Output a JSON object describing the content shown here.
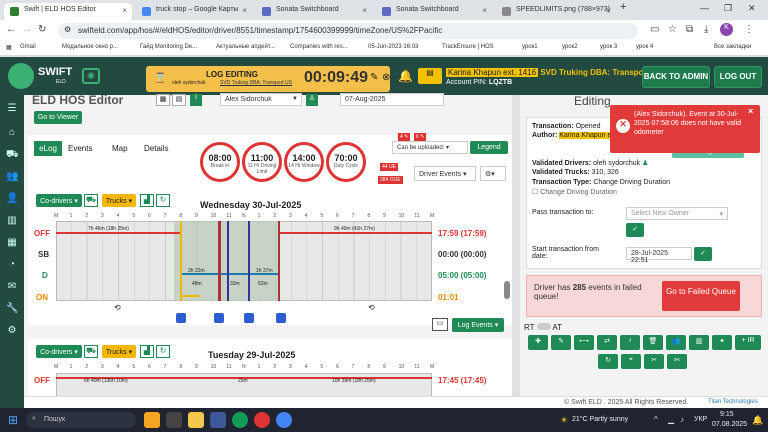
{
  "browser": {
    "tabs": [
      {
        "title": "Swift | ELD HOS Editor",
        "color": "#2e7d32",
        "active": true
      },
      {
        "title": "truck stop – Google Карты",
        "color": "#4285f4"
      },
      {
        "title": "Sonata Switchboard",
        "color": "#555"
      },
      {
        "title": "Sonata Switchboard",
        "color": "#555"
      },
      {
        "title": "SPEEDLIMITS.png (788×973)",
        "color": "#777"
      }
    ],
    "new_tab": "+",
    "url": "swifteld.com/app/hos/#/eldHOS/editor/driver/8551/timestamp/1754600399999/timeZone/US%2FPacific",
    "profile": "K",
    "bookmarks": [
      "Gmail",
      "Модальное окно р...",
      "Гайд Monitoring De...",
      "Актуальные апдейт...",
      "Companies with res...",
      "05-Jun-2023 16:03",
      "TrackEnsure | HOS",
      "урок1",
      "урок2",
      "урок 3",
      "урок 4",
      "Все закладки"
    ]
  },
  "header": {
    "logo": "SWIFT",
    "logo_sub": "ELD",
    "log_editing_label": "LOG EDITING",
    "log_editing_user": "oleh sydorchuk",
    "log_editing_company": "SVD Truking DBA: Transport US",
    "timer": "00:09:49",
    "driver_name": "Karina Khapun ext. 1416",
    "carrier": "SVD Truking DBA: Transport US",
    "account_pin_label": "Account PIN:",
    "account_pin": "LQZTB",
    "back_to_admin": "BACK TO ADMIN",
    "logout": "LOG OUT"
  },
  "editor": {
    "title": "ELD HOS Editor",
    "driver_select": "Alex Sidorchuk",
    "date": "07-Aug-2025",
    "go_to_viewer": "Go to Viewer",
    "tabs": [
      "eLog",
      "Events",
      "Map",
      "Details"
    ],
    "circles": [
      {
        "value": "08:00",
        "label": "Break in"
      },
      {
        "value": "11:00",
        "label": "11 Hr Driving Limit"
      },
      {
        "value": "14:00",
        "label": "14 Hr Window"
      },
      {
        "value": "70:00",
        "label": "Duty Cycle"
      }
    ],
    "badge_uc": "44 UE",
    "badge_ou": "284 OUE",
    "badges_top": [
      "4 ✎",
      "6 ✎"
    ],
    "can_be_uploaded": "Can be uploaded:",
    "legend": "Legend",
    "driver_events": "Driver Events",
    "codrivers": "Co-drivers",
    "trucks": "Trucks",
    "day1": {
      "title": "Wednesday 30-Jul-2025",
      "rows": [
        "OFF",
        "SB",
        "D",
        "ON"
      ],
      "totals": [
        "17:59 (17:59)",
        "00:00 (00:00)",
        "05:00 (05:00)",
        "01:01"
      ],
      "notes": [
        "7h 46m (18h 25m)",
        "9h 40m (41h 27m)",
        "2h 22m",
        "1h 37m",
        "48m",
        "33m",
        "52m"
      ]
    },
    "day2": {
      "title": "Tuesday 29-Jul-2025",
      "rows": [
        "OFF"
      ],
      "totals": [
        "17:45 (17:45)"
      ],
      "notes": [
        "6h 40m (136h 10m)",
        "25m",
        "10h 39m (18h 25m)"
      ]
    },
    "log_events": "Log Events",
    "hour_labels": [
      "M",
      "1",
      "2",
      "3",
      "4",
      "5",
      "6",
      "7",
      "8",
      "9",
      "10",
      "11",
      "N",
      "1",
      "2",
      "3",
      "4",
      "5",
      "6",
      "7",
      "8",
      "9",
      "10",
      "11",
      "M"
    ]
  },
  "panel": {
    "title": "Editing",
    "toast": "(Alex Sidorchuk). Event at 30-Jul-2025 07:58:06 does not have valid odometer",
    "transaction_label": "Transaction:",
    "transaction": "Opened",
    "author_label": "Author:",
    "author": "Karina Khapun ext. 1416",
    "add_missing": "Add missing events: 0",
    "validated_drivers_label": "Validated Drivers:",
    "validated_drivers": "oleh sydorchuk",
    "validated_trucks_label": "Validated Trucks:",
    "validated_trucks": "310, 326",
    "tx_type_label": "Transaction Type:",
    "tx_type": "Change Driving Duration",
    "tx_type_check": "Change Driving Duration",
    "pass_label": "Pass transaction to:",
    "pass_placeholder": "Select New Owner",
    "start_label": "Start transaction from date:",
    "start_value": "28-Jul-2025 22:51",
    "failed_text_pre": "Driver has ",
    "failed_count": "285",
    "failed_text_post": " events in failed queue!",
    "go_failed": "Go to Failed Queue",
    "rt": "RT",
    "at": "AT",
    "ir": "+ IR"
  },
  "footer": {
    "copyright": "© Swift ELD . 2025 All Rights Reserved.",
    "powered": "Titan Technologies"
  },
  "taskbar": {
    "search": "Пошук",
    "weather": "21°C  Partly sunny",
    "lang": "УКР",
    "time": "9:15",
    "date": "07.08.2025"
  }
}
